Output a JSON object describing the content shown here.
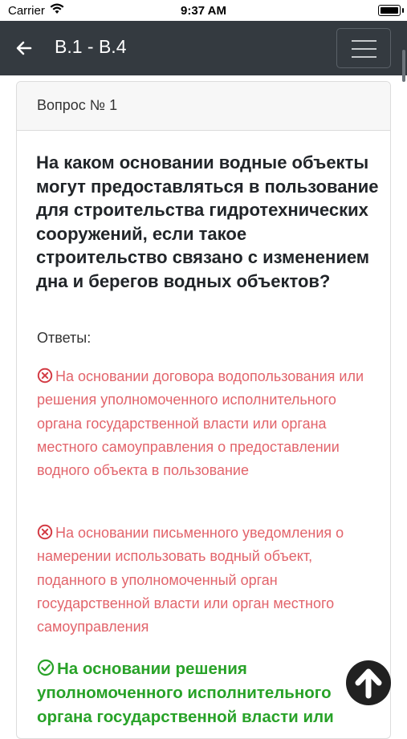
{
  "status_bar": {
    "carrier": "Carrier",
    "time": "9:37 AM"
  },
  "navbar": {
    "title": "B.1 - B.4",
    "back_icon": "arrow-left-icon",
    "menu_icon": "hamburger-icon"
  },
  "question": {
    "header": "Вопрос № 1",
    "text": "На каком основании водные объекты могут предоставляться в пользование для строительства гидротехнических сооружений, если такое строительство связано с изменением дна и берегов водных объектов?",
    "answers_label": "Ответы:"
  },
  "answers": [
    {
      "text": "На основании договора водопользования или решения уполномоченного исполнительного органа государственной власти или органа местного самоуправления о предоставлении водного объекта в пользование",
      "correct": false
    },
    {
      "text": "На основании письменного уведомления о намерении использовать водный объект, поданного в уполномоченный орган государственной власти или орган местного самоуправления",
      "correct": false
    },
    {
      "text": "На основании решения уполномоченного исполнительного органа государственной власти или",
      "correct": true
    }
  ],
  "colors": {
    "navbar": "#343a40",
    "wrong": "#e2646b",
    "correct": "#28a228"
  },
  "scroll_top_icon": "arrow-up-icon"
}
